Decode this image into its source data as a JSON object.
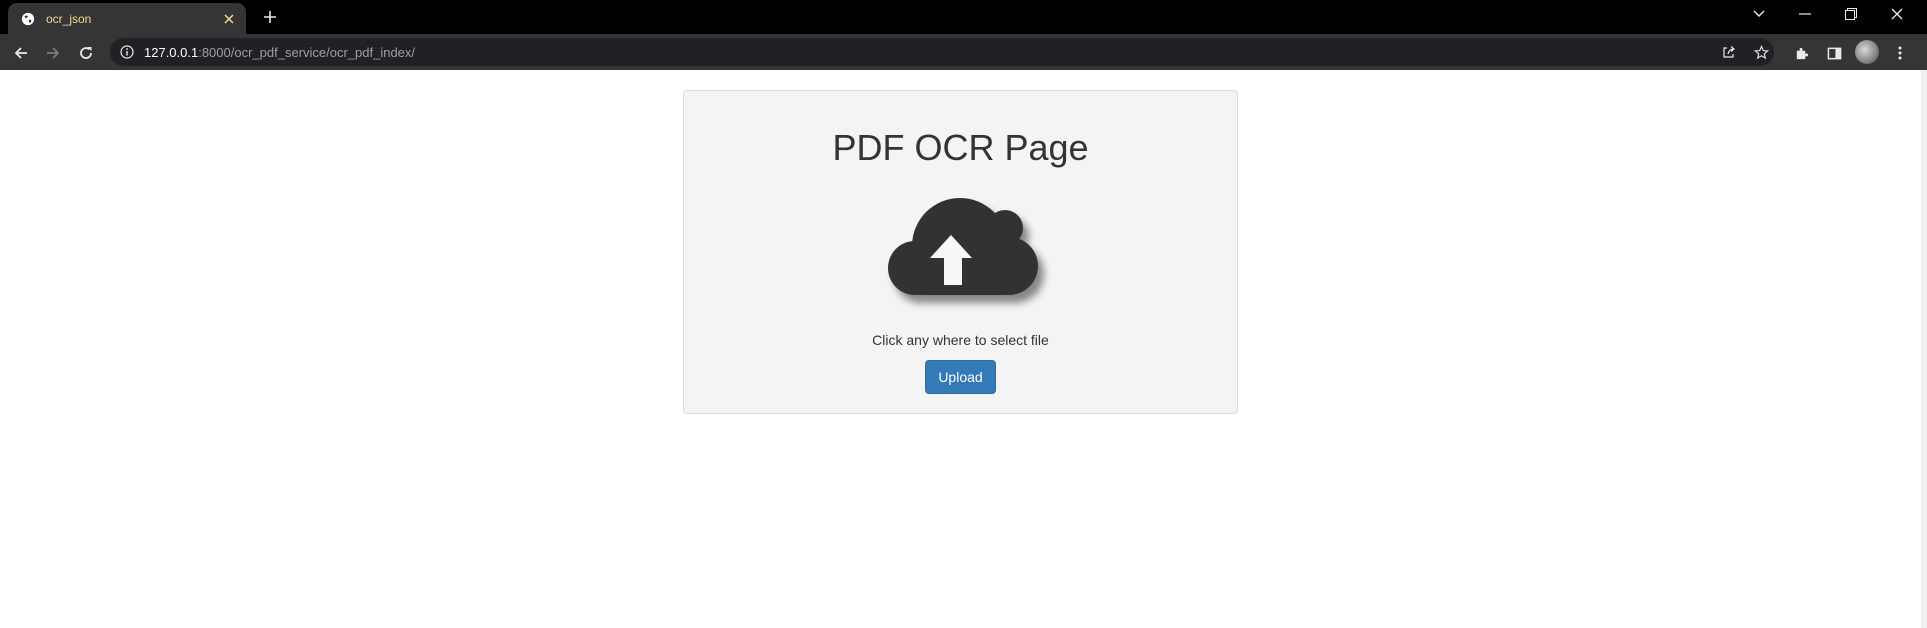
{
  "browser": {
    "tab": {
      "title": "ocr_json",
      "favicon": "globe-icon"
    },
    "omnibox": {
      "host": "127.0.0.1",
      "rest": ":8000/ocr_pdf_service/ocr_pdf_index/"
    }
  },
  "page": {
    "title": "PDF OCR Page",
    "upload_icon": "cloud-upload-icon",
    "hint": "Click any where to select file",
    "upload_label": "Upload"
  },
  "colors": {
    "tab_title": "#f0de92",
    "card_bg": "#f4f4f4",
    "button": "#337ab7",
    "icon": "#333333"
  }
}
